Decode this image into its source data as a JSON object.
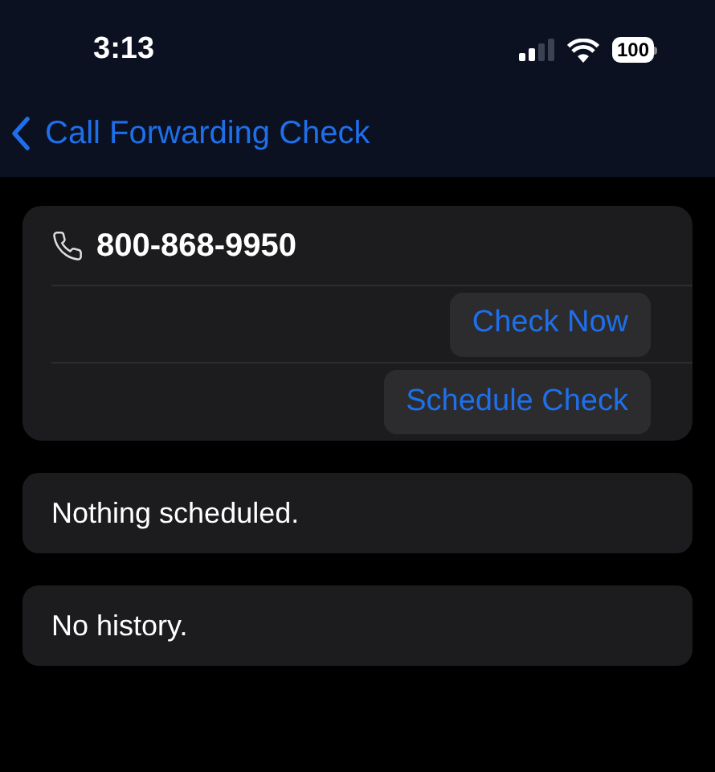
{
  "status_bar": {
    "time": "3:13",
    "battery": "100"
  },
  "nav": {
    "back_label": "Call Forwarding Check"
  },
  "number_card": {
    "phone": "800-868-9950",
    "buttons": [
      "Check Now",
      "Schedule Check"
    ]
  },
  "schedule": {
    "text": "Nothing scheduled."
  },
  "history": {
    "text": "No history."
  }
}
